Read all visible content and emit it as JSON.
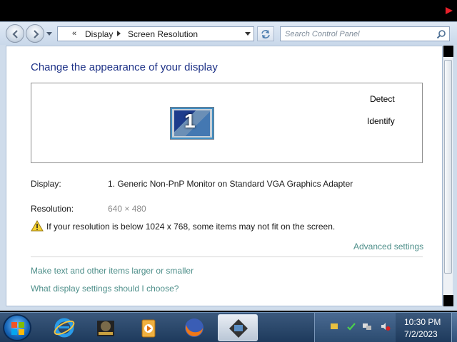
{
  "address": {
    "chevrons": "«",
    "crumbs": [
      "Display",
      "Screen Resolution"
    ]
  },
  "search": {
    "placeholder": "Search Control Panel"
  },
  "main": {
    "title": "Change the appearance of your display",
    "monitor_number": "1",
    "detect_label": "Detect",
    "identify_label": "Identify",
    "display_label": "Display:",
    "display_value": "1. Generic Non-PnP Monitor on Standard VGA Graphics Adapter",
    "resolution_label": "Resolution:",
    "resolution_value": "640 × 480",
    "warning_text": "If your resolution is below 1024 x 768, some items may not fit on the screen.",
    "advanced_link": "Advanced settings",
    "text_size_link": "Make text and other items larger or smaller",
    "help_link": "What display settings should I choose?"
  },
  "colors": {
    "link": "#4e8f8a",
    "title": "#1e3287",
    "taskbar": "#2a4a6e"
  },
  "taskbar": {
    "items": [
      "internet-explorer",
      "app",
      "media-player",
      "firefox",
      "control-panel"
    ],
    "active": "control-panel"
  },
  "clock": {
    "time": "10:30 PM",
    "date": "7/2/2023"
  }
}
